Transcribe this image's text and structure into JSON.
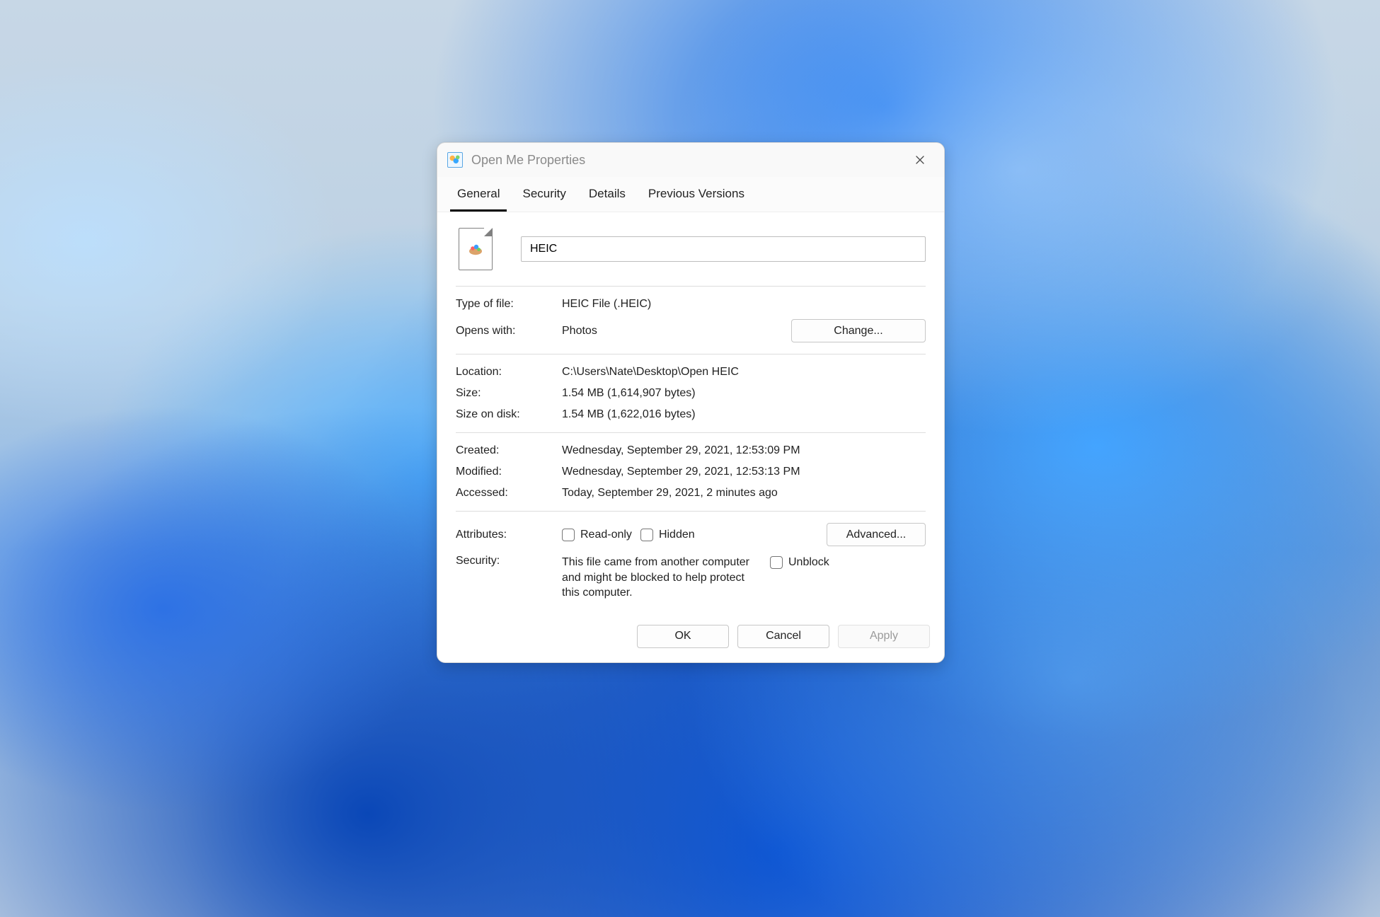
{
  "title": "Open Me Properties",
  "tabs": {
    "general": "General",
    "security": "Security",
    "details": "Details",
    "previous": "Previous Versions"
  },
  "fileName": "HEIC",
  "labels": {
    "typeOfFile": "Type of file:",
    "opensWith": "Opens with:",
    "change": "Change...",
    "location": "Location:",
    "size": "Size:",
    "sizeOnDisk": "Size on disk:",
    "created": "Created:",
    "modified": "Modified:",
    "accessed": "Accessed:",
    "attributes": "Attributes:",
    "readOnly": "Read-only",
    "hidden": "Hidden",
    "advanced": "Advanced...",
    "security": "Security:",
    "unblock": "Unblock"
  },
  "values": {
    "typeOfFile": "HEIC File (.HEIC)",
    "opensWith": "Photos",
    "location": "C:\\Users\\Nate\\Desktop\\Open HEIC",
    "size": "1.54 MB (1,614,907 bytes)",
    "sizeOnDisk": "1.54 MB (1,622,016 bytes)",
    "created": "Wednesday, September 29, 2021, 12:53:09 PM",
    "modified": "Wednesday, September 29, 2021, 12:53:13 PM",
    "accessed": "Today, September 29, 2021, 2 minutes ago",
    "securityNotice": "This file came from another computer and might be blocked to help protect this computer."
  },
  "footer": {
    "ok": "OK",
    "cancel": "Cancel",
    "apply": "Apply"
  }
}
